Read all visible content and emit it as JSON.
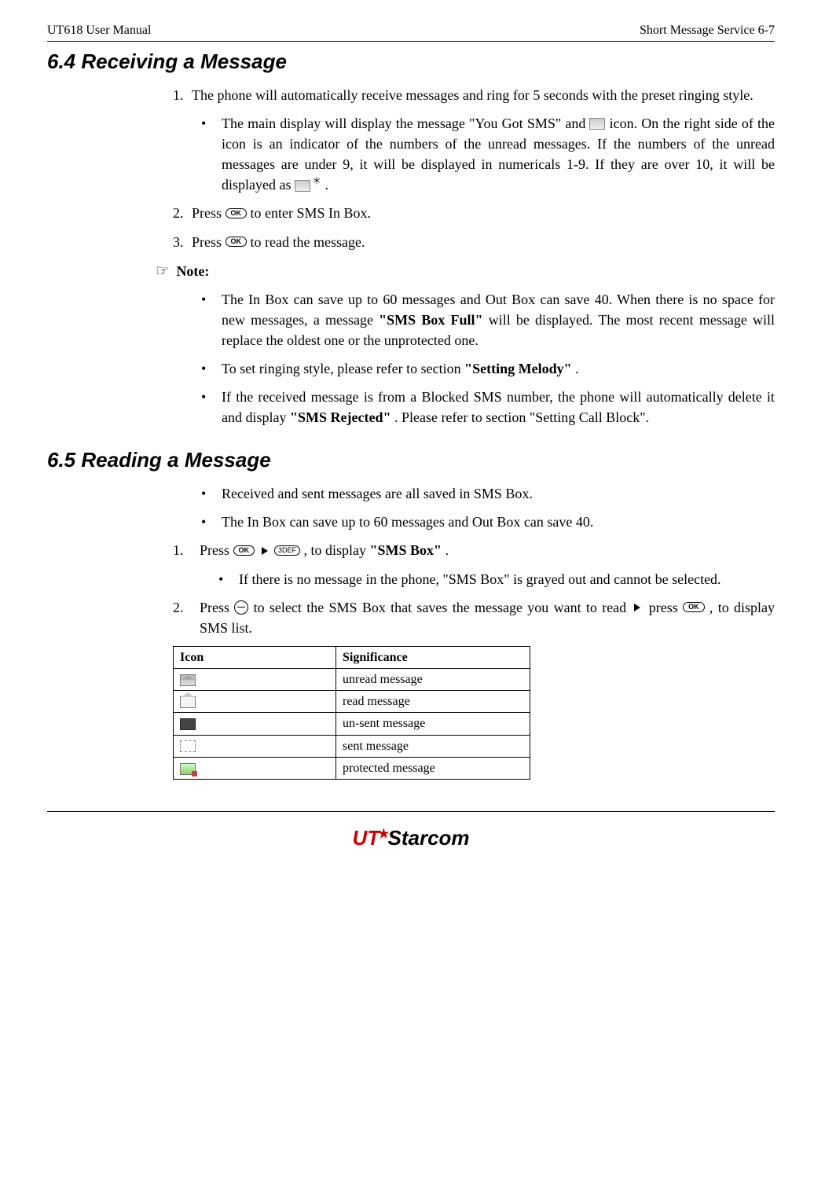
{
  "header": {
    "left": "UT618 User Manual",
    "right": "Short Message Service   6-7"
  },
  "section64": {
    "title": "6.4   Receiving a Message",
    "item1": {
      "num": "1.",
      "text": "The phone will automatically receive messages and ring for 5 seconds with the preset ringing style."
    },
    "bullet1a": "The main display will display the message \"You Got SMS\" and ",
    "bullet1b": " icon. On the right side of the icon is an indicator of the numbers of the unread messages. If the numbers of the unread messages are under 9, it will be displayed in numericals 1-9. If they are over 10, it will be displayed as ",
    "bullet1c": ".",
    "iconStar": "＊",
    "item2": {
      "num": "2.",
      "pre": "Press ",
      "post": " to enter SMS In Box."
    },
    "item3": {
      "num": "3.",
      "pre": "Press ",
      "post": " to read the message."
    },
    "noteLabel": " Note:",
    "note1a": "The In Box can save up to 60 messages and Out Box can save 40. When there is no space for new messages, a message ",
    "note1b": "\"SMS Box Full\"",
    "note1c": " will be displayed. The most recent message will replace the oldest one or the unprotected one.",
    "note2a": "To set ringing style, please refer to section ",
    "note2b": "\"Setting Melody\"",
    "note2c": ".",
    "note3a": " If the received message is from a Blocked SMS number, the phone will automatically delete it and display ",
    "note3b": "\"SMS Rejected\"",
    "note3c": ". Please refer to section \"Setting Call Block\"."
  },
  "section65": {
    "title": "6.5   Reading a Message",
    "bullet1": "Received and sent messages are all saved in SMS Box.",
    "bullet2": "The In Box can save up to 60 messages and Out Box can save 40.",
    "step1": {
      "num": "1.",
      "pre": "Press ",
      "mid": ", to display ",
      "bold": "\"SMS Box\"",
      "post": "."
    },
    "step1sub": "If there is no message in the phone, \"SMS Box\" is grayed out and cannot be selected.",
    "step2": {
      "num": "2.",
      "pre": "Press ",
      "mid1": " to select the SMS Box that saves the message you want to read ",
      "mid2": " press ",
      "post": ", to display SMS list."
    },
    "table": {
      "headIcon": "Icon",
      "headSig": "Significance",
      "rows": [
        {
          "sig": "unread message"
        },
        {
          "sig": "read message"
        },
        {
          "sig": "un-sent message"
        },
        {
          "sig": "sent message"
        },
        {
          "sig": "protected message"
        }
      ]
    }
  },
  "keys": {
    "ok": "OK",
    "three": "3DEF"
  },
  "footer": {
    "ut": "UT",
    "starcom": "Starcom"
  }
}
